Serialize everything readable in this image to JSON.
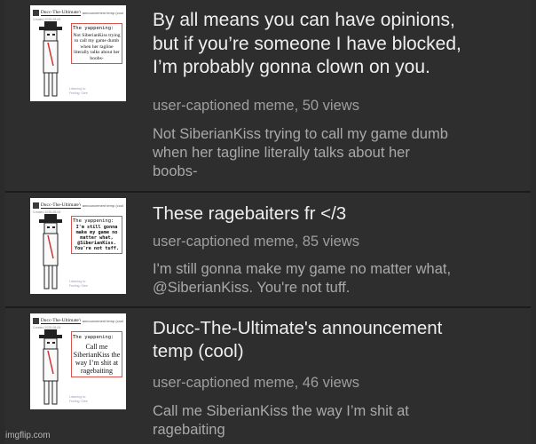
{
  "thumbnail": {
    "header_name": "Ducc-The-Ultimate's",
    "header_sub": "announcement temp (cool)",
    "date_line": "Created 2025-08-09",
    "footer_lines": [
      "Listening to:",
      "Feeling: Glee"
    ]
  },
  "posts": [
    {
      "title_lines": [
        "By all means you can have opinions,",
        "but if you’re someone I have blocked,",
        "I’m probably gonna clown on you."
      ],
      "meta": "user-captioned meme, 50 views",
      "description_lines": [
        "Not SiberianKiss trying to call my game dumb",
        "when her tagline literally talks about her",
        "boobs-"
      ],
      "bubble_label": "The yappening:",
      "bubble_text": "Not SiberianKiss trying to call my game dumb when her tagline literally talks about her boobs-"
    },
    {
      "title_lines": [
        "These ragebaiters fr </3"
      ],
      "meta": "user-captioned meme, 85 views",
      "description_lines": [
        "I'm still gonna make my game no matter what,",
        "@SiberianKiss. You're not tuff."
      ],
      "bubble_label": "The yappening:",
      "bubble_text": "I'm still gonna make my game no matter what, @SiberianKiss. You're not tuff."
    },
    {
      "title_lines": [
        "Ducc-The-Ultimate's announcement",
        "temp (cool)"
      ],
      "meta": "user-captioned meme, 46 views",
      "description_lines": [
        "Call me SiberianKiss the way I’m shit at",
        "ragebaiting"
      ],
      "bubble_label": "The yappening:",
      "bubble_text": "Call me SiberianKiss the way I’m shit at ragebaiting"
    }
  ],
  "watermark": "imgflip.com"
}
